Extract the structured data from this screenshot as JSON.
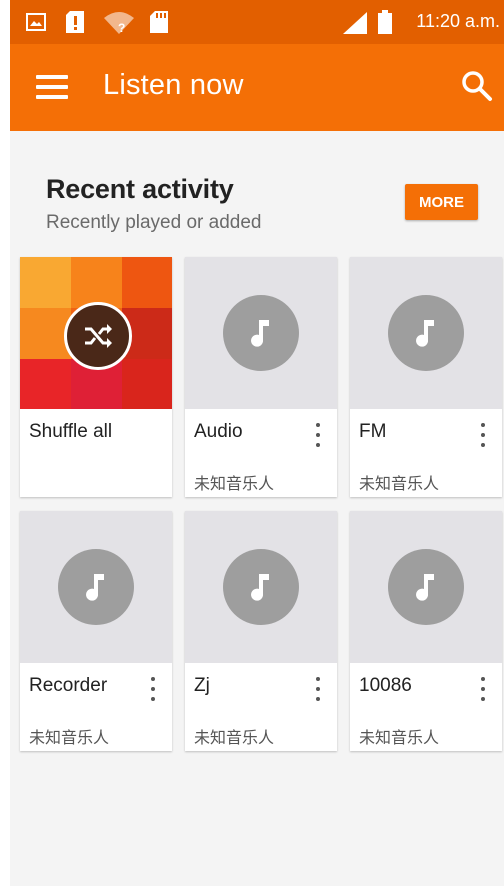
{
  "status_bar": {
    "time": "11:20 a.m.",
    "icons": [
      "image-icon",
      "alert-icon",
      "wifi-question-icon",
      "sd-card-icon",
      "signal-icon",
      "battery-icon"
    ]
  },
  "app_bar": {
    "title": "Listen now",
    "menu_icon": "menu-icon",
    "search_icon": "search-icon",
    "color": "#f46f06",
    "status_color": "#e25f00"
  },
  "recent": {
    "title": "Recent activity",
    "subtitle": "Recently played or added",
    "more_label": "MORE"
  },
  "cards": [
    {
      "title": "Shuffle all",
      "subtitle": ""
    },
    {
      "title": "Audio",
      "subtitle": "未知音乐人"
    },
    {
      "title": "FM",
      "subtitle": "未知音乐人"
    },
    {
      "title": "Recorder",
      "subtitle": "未知音乐人"
    },
    {
      "title": "Zj",
      "subtitle": "未知音乐人"
    },
    {
      "title": "10086",
      "subtitle": "未知音乐人"
    }
  ]
}
